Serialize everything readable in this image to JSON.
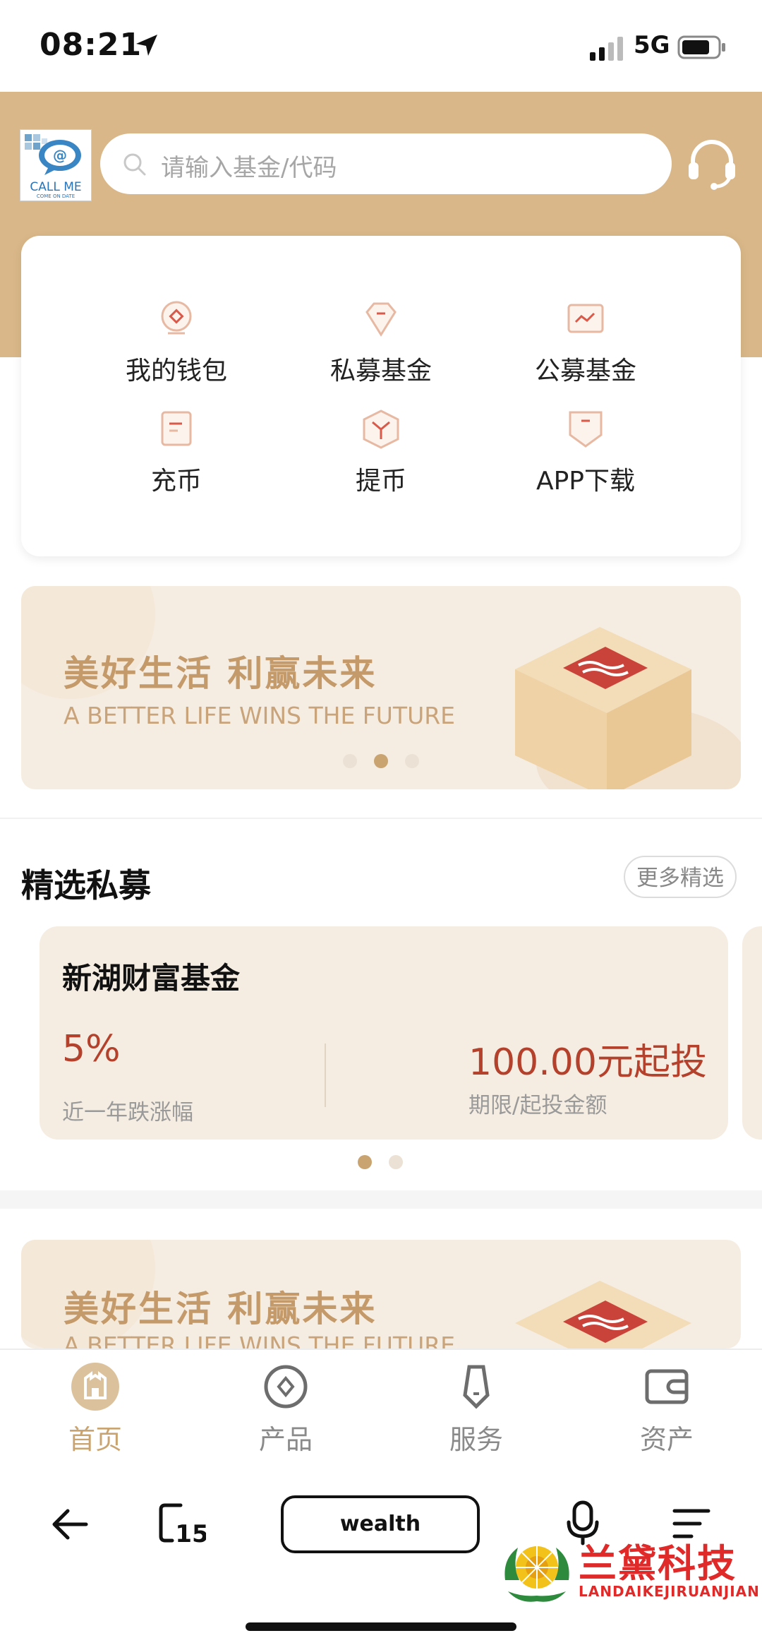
{
  "status_bar": {
    "time": "08:21",
    "network": "5G"
  },
  "header": {
    "logo_text": "CALL ME",
    "logo_subtext": "COME ON DATE",
    "search_placeholder": "请输入基金/代码"
  },
  "quick_menu": [
    {
      "label": "我的钱包",
      "icon": "wallet-icon"
    },
    {
      "label": "私募基金",
      "icon": "private-fund-icon"
    },
    {
      "label": "公募基金",
      "icon": "public-fund-icon"
    },
    {
      "label": "充币",
      "icon": "deposit-icon"
    },
    {
      "label": "提币",
      "icon": "withdraw-icon"
    },
    {
      "label": "APP下载",
      "icon": "app-download-icon"
    }
  ],
  "banner": {
    "title": "美好生活 利赢未来",
    "subtitle": "A BETTER LIFE WINS THE FUTURE",
    "active_slide": 2,
    "slides": 3
  },
  "section": {
    "title": "精选私募",
    "more_label": "更多精选"
  },
  "fund_card": {
    "name": "新湖财富基金",
    "rate": "5%",
    "rate_label": "近一年跌涨幅",
    "amount": "100.00元起投",
    "amount_label": "期限/起投金额",
    "active_page": 1,
    "pages": 2
  },
  "tabs": [
    {
      "label": "首页",
      "icon": "home-icon",
      "active": true
    },
    {
      "label": "产品",
      "icon": "product-icon",
      "active": false
    },
    {
      "label": "服务",
      "icon": "service-icon",
      "active": false
    },
    {
      "label": "资产",
      "icon": "assets-icon",
      "active": false
    }
  ],
  "browser": {
    "address_label": "wealth",
    "tabs_count": "15"
  },
  "watermark": {
    "text": "兰黛科技",
    "subtext": "LANDAIKEJIRUANJIAN"
  },
  "colors": {
    "brand_gold": "#d9b788",
    "accent_gold": "#c9a470",
    "price_red": "#b3412c",
    "card_bg": "#f6ede2"
  }
}
